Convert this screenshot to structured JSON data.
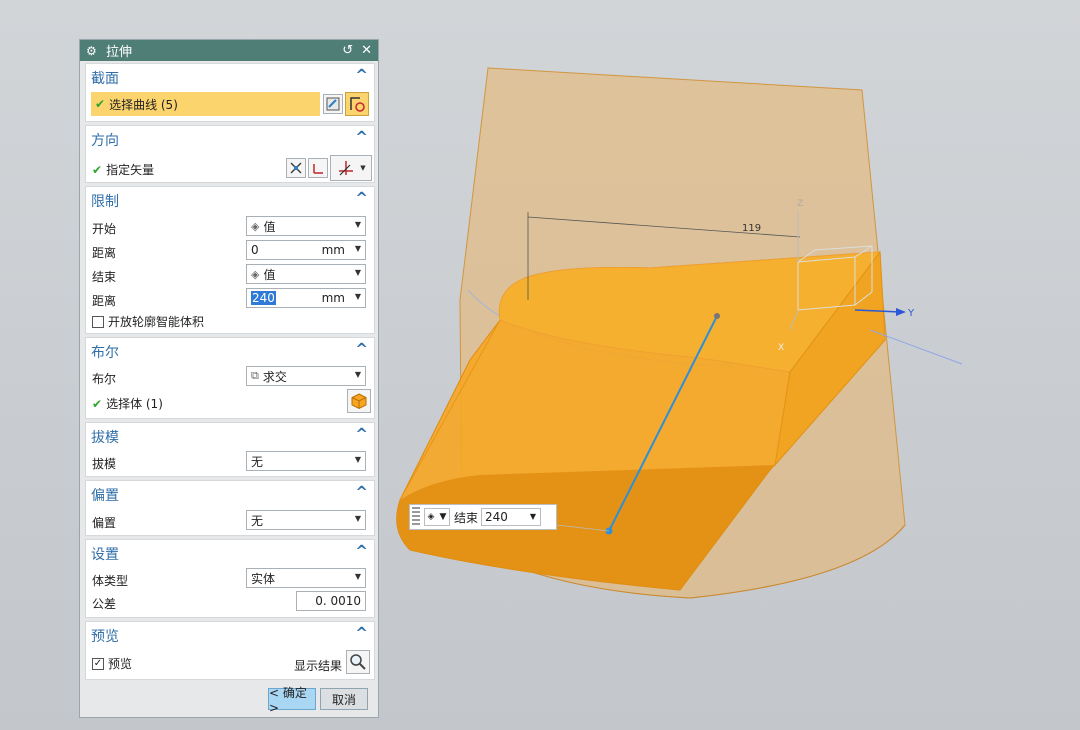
{
  "dialog": {
    "title": "拉伸",
    "sections": {
      "section": {
        "title": "截面",
        "select_curve": "选择曲线 (5)"
      },
      "direction": {
        "title": "方向",
        "specify_vector": "指定矢量"
      },
      "limits": {
        "title": "限制",
        "start_label": "开始",
        "start_value": "值",
        "start_distance_label": "距离",
        "start_distance": "0",
        "start_unit": "mm",
        "end_label": "结束",
        "end_value": "值",
        "end_distance_label": "距离",
        "end_distance": "240",
        "end_unit": "mm",
        "open_profile": "开放轮廓智能体积"
      },
      "boolean": {
        "title": "布尔",
        "boolean_label": "布尔",
        "boolean_value": "求交",
        "select_body": "选择体 (1)"
      },
      "draft": {
        "title": "拔模",
        "draft_label": "拔模",
        "draft_value": "无"
      },
      "offset": {
        "title": "偏置",
        "offset_label": "偏置",
        "offset_value": "无"
      },
      "settings": {
        "title": "设置",
        "body_type_label": "体类型",
        "body_type_value": "实体",
        "tolerance_label": "公差",
        "tolerance_value": "0. 0010"
      },
      "preview": {
        "title": "预览",
        "preview_label": "预览",
        "show_result": "显示结果"
      }
    },
    "ok_label": "< 确定 >",
    "cancel_label": "取消"
  },
  "viewport": {
    "dimension_label": "119",
    "axis_x": "X",
    "axis_y": "Y",
    "axis_z": "Z",
    "float_toolbar": {
      "label": "结束",
      "value": "240"
    }
  },
  "colors": {
    "title_bar": "#4f7e77",
    "section_title": "#2f6ea8",
    "selection_highlight": "#fcd46e",
    "solid_body": "#f6a623",
    "transparent_body": "#e9b56a",
    "vector_line": "#2f8fd6"
  }
}
